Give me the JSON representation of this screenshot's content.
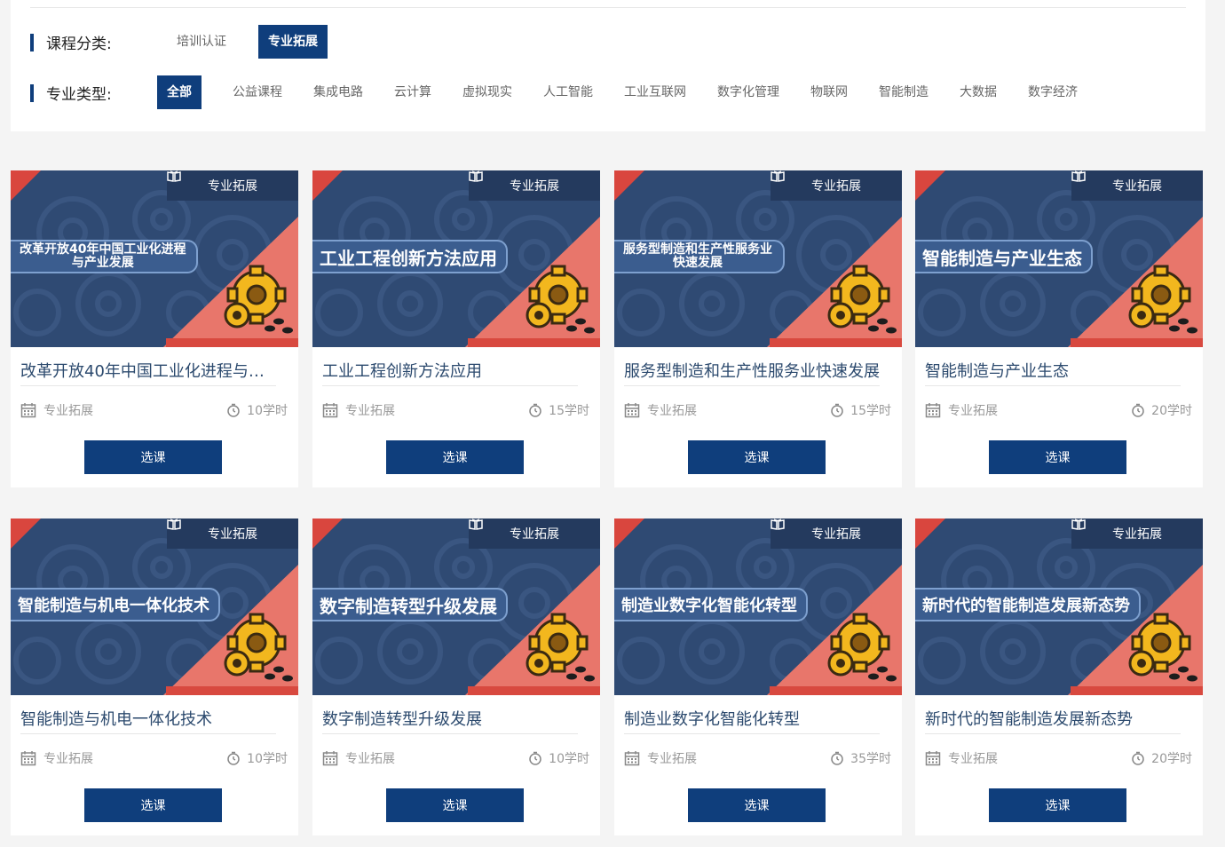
{
  "filters": {
    "category": {
      "label": "课程分类:",
      "options": [
        {
          "label": "培训认证",
          "active": false
        },
        {
          "label": "专业拓展",
          "active": true
        }
      ]
    },
    "type": {
      "label": "专业类型:",
      "options": [
        {
          "label": "全部",
          "active": true
        },
        {
          "label": "公益课程",
          "active": false
        },
        {
          "label": "集成电路",
          "active": false
        },
        {
          "label": "云计算",
          "active": false
        },
        {
          "label": "虚拟现实",
          "active": false
        },
        {
          "label": "人工智能",
          "active": false
        },
        {
          "label": "工业互联网",
          "active": false
        },
        {
          "label": "数字化管理",
          "active": false
        },
        {
          "label": "物联网",
          "active": false
        },
        {
          "label": "智能制造",
          "active": false
        },
        {
          "label": "大数据",
          "active": false
        },
        {
          "label": "数字经济",
          "active": false
        }
      ]
    }
  },
  "courses": [
    {
      "thumb_tag": "专业拓展",
      "banner_lines": [
        "改革开放40年中国工业化进程",
        "与产业发展"
      ],
      "banner_style": "small",
      "title": "改革开放40年中国工业化进程与产...",
      "category": "专业拓展",
      "hours": "10学时",
      "button": "选课"
    },
    {
      "thumb_tag": "专业拓展",
      "banner_lines": [
        "工业工程创新方法应用"
      ],
      "banner_style": "big",
      "title": "工业工程创新方法应用",
      "category": "专业拓展",
      "hours": "15学时",
      "button": "选课"
    },
    {
      "thumb_tag": "专业拓展",
      "banner_lines": [
        "服务型制造和生产性服务业",
        "快速发展"
      ],
      "banner_style": "small",
      "title": "服务型制造和生产性服务业快速发展",
      "category": "专业拓展",
      "hours": "15学时",
      "button": "选课"
    },
    {
      "thumb_tag": "专业拓展",
      "banner_lines": [
        "智能制造与产业生态"
      ],
      "banner_style": "big",
      "title": "智能制造与产业生态",
      "category": "专业拓展",
      "hours": "20学时",
      "button": "选课"
    },
    {
      "thumb_tag": "专业拓展",
      "banner_lines": [
        "智能制造与机电一体化技术"
      ],
      "banner_style": "med",
      "title": "智能制造与机电一体化技术",
      "category": "专业拓展",
      "hours": "10学时",
      "button": "选课"
    },
    {
      "thumb_tag": "专业拓展",
      "banner_lines": [
        "数字制造转型升级发展"
      ],
      "banner_style": "big",
      "title": "数字制造转型升级发展",
      "category": "专业拓展",
      "hours": "10学时",
      "button": "选课"
    },
    {
      "thumb_tag": "专业拓展",
      "banner_lines": [
        "制造业数字化智能化转型"
      ],
      "banner_style": "med",
      "title": "制造业数字化智能化转型",
      "category": "专业拓展",
      "hours": "35学时",
      "button": "选课"
    },
    {
      "thumb_tag": "专业拓展",
      "banner_lines": [
        "新时代的智能制造发展新态势"
      ],
      "banner_style": "med",
      "title": "新时代的智能制造发展新态势",
      "category": "专业拓展",
      "hours": "20学时",
      "button": "选课"
    }
  ]
}
